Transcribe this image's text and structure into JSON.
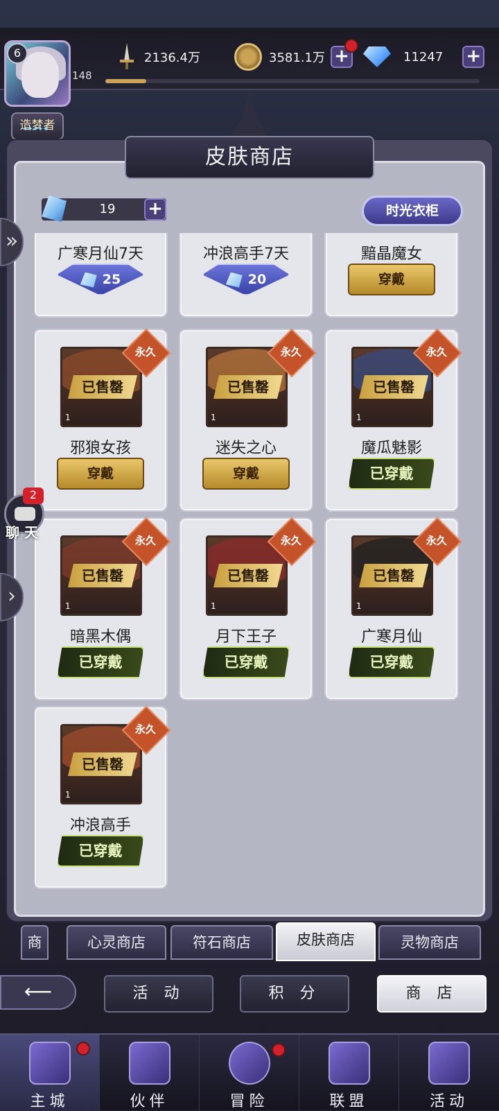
{
  "player": {
    "level": "6",
    "xp": "148",
    "xp_fraction": 0.11,
    "title": "造梦者"
  },
  "resources": {
    "power": "2136.4万",
    "gold": "3581.1万",
    "diamonds": "11247"
  },
  "header": {
    "title": "皮肤商店"
  },
  "currency": {
    "amount": "19",
    "wardrobe_label": "时光衣柜"
  },
  "chat": {
    "badge": "2",
    "label": "聊 天"
  },
  "items": [
    {
      "name": "广寒月仙7天",
      "button": "25",
      "type": "gem"
    },
    {
      "name": "冲浪高手7天",
      "button": "20",
      "type": "gem"
    },
    {
      "name": "黯晶魔女",
      "button": "穿戴",
      "type": "wear"
    },
    {
      "name": "邪狼女孩",
      "button": "穿戴",
      "type": "wear",
      "tag": "永久",
      "sold": "已售罄",
      "count": "1"
    },
    {
      "name": "迷失之心",
      "button": "穿戴",
      "type": "wear",
      "tag": "永久",
      "sold": "已售罄",
      "count": "1"
    },
    {
      "name": "魔瓜魅影",
      "button": "已穿戴",
      "type": "worn",
      "tag": "永久",
      "sold": "已售罄",
      "count": "1"
    },
    {
      "name": "暗黑木偶",
      "button": "已穿戴",
      "type": "worn",
      "tag": "永久",
      "sold": "已售罄",
      "count": "1"
    },
    {
      "name": "月下王子",
      "button": "已穿戴",
      "type": "worn",
      "tag": "永久",
      "sold": "已售罄",
      "count": "1"
    },
    {
      "name": "广寒月仙",
      "button": "已穿戴",
      "type": "worn",
      "tag": "永久",
      "sold": "已售罄",
      "count": "1"
    },
    {
      "name": "冲浪高手",
      "button": "已穿戴",
      "type": "worn",
      "tag": "永久",
      "sold": "已售罄",
      "count": "1"
    }
  ],
  "shop_tabs": [
    "商店",
    "心灵商店",
    "符石商店",
    "皮肤商店",
    "灵物商店"
  ],
  "subnav": [
    "活 动",
    "积 分",
    "商 店"
  ],
  "bottom_nav": [
    "主城",
    "伙伴",
    "冒险",
    "联盟",
    "活动"
  ],
  "colors": {
    "accent": "#6a68c8",
    "gold_button": "#e9c76a",
    "worn": "#c7e07a",
    "badge_red": "#d3202a"
  }
}
